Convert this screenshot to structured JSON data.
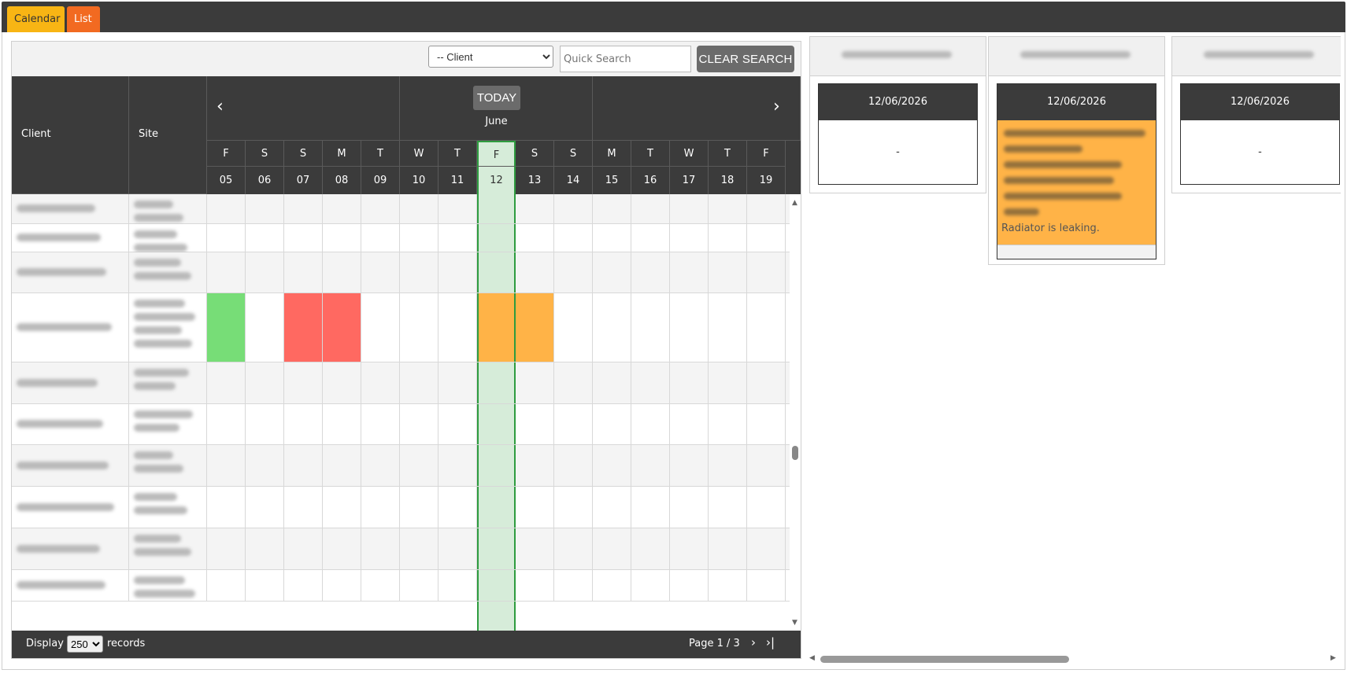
{
  "tabs": {
    "calendar": "Calendar",
    "list": "List"
  },
  "search": {
    "client_selected": "-- Client",
    "quick_placeholder": "Quick Search",
    "clear_label": "CLEAR SEARCH"
  },
  "header": {
    "client": "Client",
    "site": "Site",
    "today_label": "TODAY",
    "month": "June",
    "prev_icon": "chevron-left-icon",
    "next_icon": "chevron-right-icon"
  },
  "days": [
    {
      "letter": "F",
      "num": "05"
    },
    {
      "letter": "S",
      "num": "06"
    },
    {
      "letter": "S",
      "num": "07"
    },
    {
      "letter": "M",
      "num": "08"
    },
    {
      "letter": "T",
      "num": "09"
    },
    {
      "letter": "W",
      "num": "10"
    },
    {
      "letter": "T",
      "num": "11"
    },
    {
      "letter": "F",
      "num": "12"
    },
    {
      "letter": "S",
      "num": "13"
    },
    {
      "letter": "S",
      "num": "14"
    },
    {
      "letter": "M",
      "num": "15"
    },
    {
      "letter": "T",
      "num": "16"
    },
    {
      "letter": "W",
      "num": "17"
    },
    {
      "letter": "T",
      "num": "18"
    },
    {
      "letter": "F",
      "num": "19"
    }
  ],
  "today_index": 7,
  "events": [
    {
      "row": 3,
      "day": 0,
      "status": "green"
    },
    {
      "row": 3,
      "day": 2,
      "status": "red"
    },
    {
      "row": 3,
      "day": 3,
      "status": "red"
    },
    {
      "row": 3,
      "day": 7,
      "status": "orange"
    },
    {
      "row": 3,
      "day": 8,
      "status": "orange"
    }
  ],
  "colors": {
    "green": "#77dd77",
    "red": "#ff6961",
    "orange": "#ffb347",
    "today": "#2e9c3f",
    "dark": "#3b3b3b"
  },
  "footer": {
    "display_label": "Display",
    "records_selected": "250",
    "records_label": "records",
    "page_label": "Page 1 / 3",
    "next_icon": "next-page-icon",
    "last_icon": "last-page-icon"
  },
  "cards": [
    {
      "date": "12/06/2026",
      "content": "-"
    },
    {
      "date": "12/06/2026",
      "note": "Radiator is leaking."
    },
    {
      "date": "12/06/2026",
      "content": "-"
    }
  ]
}
